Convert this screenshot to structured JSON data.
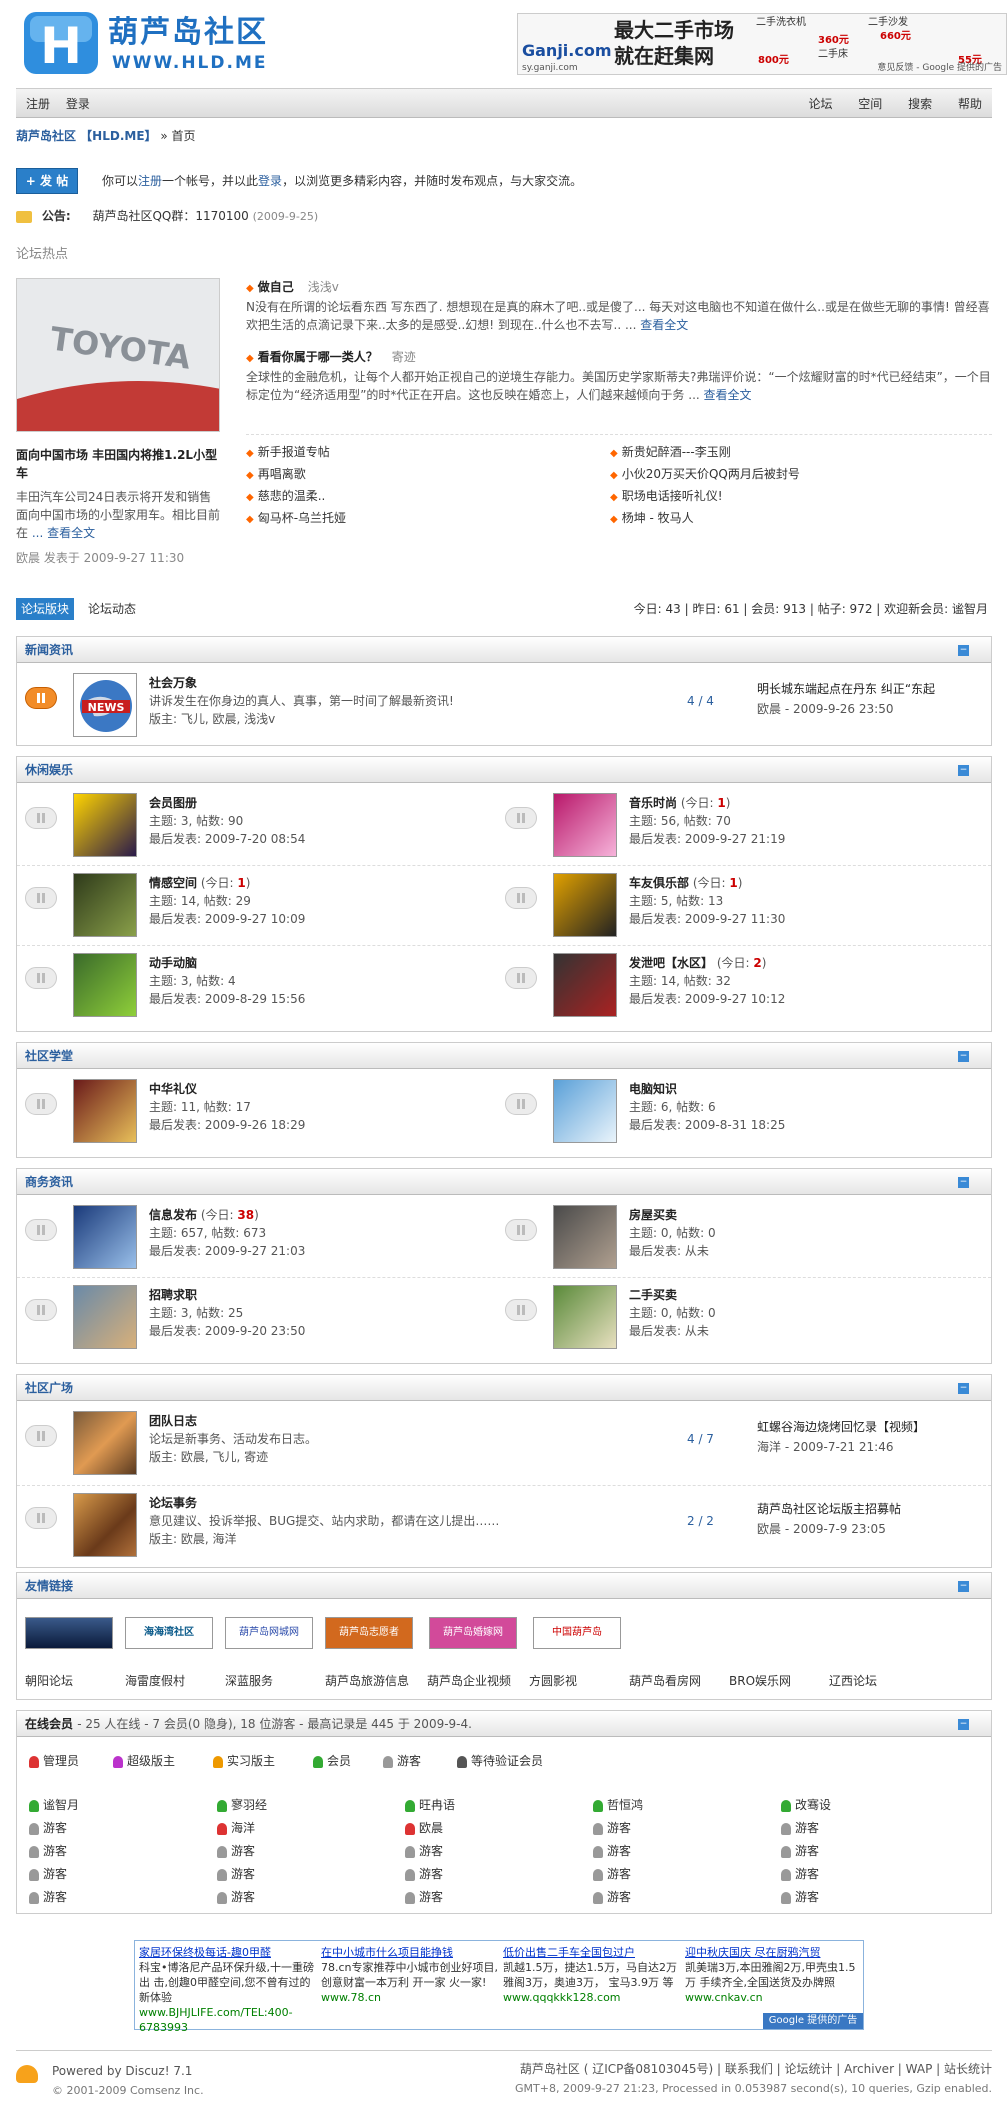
{
  "header": {
    "logo_title": "葫芦岛社区",
    "logo_url": "WWW.HLD.ME",
    "ad_brand": "Ganji.com",
    "ad_slogan1": "最大二手市场",
    "ad_slogan2": "就在赶集网",
    "ad_price1": "800元",
    "ad_price2": "360元",
    "ad_price3": "660元",
    "ad_price4": "55元",
    "ad_item1": "二手洗衣机",
    "ad_item2": "二手沙发",
    "ad_item3": "二手床",
    "ad_url": "sy.ganji.com",
    "ad_feedback": "意见反馈 - Google 提供的广告"
  },
  "nav": {
    "left": [
      "注册",
      "登录"
    ],
    "right": [
      "论坛",
      "空间",
      "搜索",
      "帮助"
    ]
  },
  "crumb": {
    "site": "葫芦岛社区 【HLD.ME】",
    "sep": "»",
    "page": "首页"
  },
  "post": {
    "button": "+ 发 帖",
    "text_pre": "你可以",
    "register": "注册",
    "text_mid": "一个帐号，并以此",
    "login": "登录",
    "text_post": "，以浏览更多精彩内容，并随时发布观点，与大家交流。"
  },
  "notice": {
    "label": "公告:",
    "text": "葫芦岛社区QQ群：1170100",
    "date": "(2009-9-25)"
  },
  "hot": {
    "label": "论坛热点",
    "img_text": "TOYOTA",
    "title": "面向中国市场 丰田国内将推1.2L小型车",
    "desc": "丰田汽车公司24日表示将开发和销售面向中国市场的小型家用车。相比目前在",
    "more": "... 查看全文",
    "author": "欧晨 发表于 2009-9-27 11:30",
    "items": [
      {
        "title": "做自己",
        "author": "浅浅v",
        "desc": "N没有在所谓的论坛看东西 写东西了. 想想现在是真的麻木了吧..或是傻了... 每天对这电脑也不知道在做什么..或是在做些无聊的事情! 曾经喜欢把生活的点滴记录下来..太多的是感受..幻想! 到现在..什么也不去写.. ...",
        "more": "查看全文"
      },
      {
        "title": "看看你属于哪一类人？",
        "author": "寄迹",
        "desc": "全球性的金融危机，让每个人都开始正视自己的逆境生存能力。美国历史学家斯蒂夫?弗瑞评价说：“一个炫耀财富的时*代已经结束”，一个目标定位为“经济适用型”的时*代正在开启。这也反映在婚恋上，人们越来越倾向于务 ...",
        "more": "查看全文"
      }
    ],
    "links_left": [
      "新手报道专帖",
      "再唱离歌",
      "慈悲的温柔..",
      "匈马杯-乌兰托娅"
    ],
    "links_right": [
      "新贵妃醉酒---李玉刚",
      "小伙20万买天价QQ两月后被封号",
      "职场电话接听礼仪!",
      "杨坤 - 牧马人"
    ]
  },
  "tabs": {
    "active": "论坛版块",
    "other": "论坛动态"
  },
  "stats": "今日: 43 | 昨日: 61 | 会员: 913 | 帖子: 972 | 欢迎新会员: 谧智月",
  "sections": [
    {
      "title": "新闻资讯",
      "collapse": "−",
      "forums": [
        {
          "name": "社会万象",
          "line2": "讲诉发生在你身边的真人、真事，第一时间了解最新资讯!",
          "line3": "版主: 飞儿, 欧晨, 浅浅v",
          "count": "4 / 4",
          "last_title": "明长城东端起点在丹东 纠正“东起",
          "last_author": "欧晨 - 2009-9-26 23:50"
        }
      ]
    },
    {
      "title": "休闲娱乐",
      "collapse": "−",
      "forums": [
        {
          "name": "会员图册",
          "today": "",
          "stats": "主题: 3, 帖数: 90",
          "last": "最后发表: 2009-7-20 08:54"
        },
        {
          "name": "音乐时尚",
          "today": "1",
          "stats": "主题: 56, 帖数: 70",
          "last": "最后发表: 2009-9-27 21:19"
        },
        {
          "name": "情感空间",
          "today": "1",
          "stats": "主题: 14, 帖数: 29",
          "last": "最后发表: 2009-9-27 10:09"
        },
        {
          "name": "车友俱乐部",
          "today": "1",
          "stats": "主题: 5, 帖数: 13",
          "last": "最后发表: 2009-9-27 11:30"
        },
        {
          "name": "动手动脑",
          "today": "",
          "stats": "主题: 3, 帖数: 4",
          "last": "最后发表: 2009-8-29 15:56"
        },
        {
          "name": "发泄吧【水区】",
          "today": "2",
          "stats": "主题: 14, 帖数: 32",
          "last": "最后发表: 2009-9-27 10:12"
        }
      ]
    },
    {
      "title": "社区学堂",
      "collapse": "−",
      "forums": [
        {
          "name": "中华礼仪",
          "today": "",
          "stats": "主题: 11, 帖数: 17",
          "last": "最后发表: 2009-9-26 18:29"
        },
        {
          "name": "电脑知识",
          "today": "",
          "stats": "主题: 6, 帖数: 6",
          "last": "最后发表: 2009-8-31 18:25"
        }
      ]
    },
    {
      "title": "商务资讯",
      "collapse": "−",
      "forums": [
        {
          "name": "信息发布",
          "today": "38",
          "stats": "主题: 657, 帖数: 673",
          "last": "最后发表: 2009-9-27 21:03"
        },
        {
          "name": "房屋买卖",
          "today": "",
          "stats": "主题: 0, 帖数: 0",
          "last": "最后发表: 从未"
        },
        {
          "name": "招聘求职",
          "today": "",
          "stats": "主题: 3, 帖数: 25",
          "last": "最后发表: 2009-9-20 23:50"
        },
        {
          "name": "二手买卖",
          "today": "",
          "stats": "主题: 0, 帖数: 0",
          "last": "最后发表: 从未"
        }
      ]
    },
    {
      "title": "社区广场",
      "collapse": "−",
      "forums": [
        {
          "name": "团队日志",
          "line2": "论坛是新事务、活动发布日志。",
          "line3": "版主: 欧晨, 飞儿, 寄迹",
          "count": "4 / 7",
          "last_title": "虹螺谷海边烧烤回忆录【视频】",
          "last_author": "海洋 - 2009-7-21 21:46"
        },
        {
          "name": "论坛事务",
          "line2": "意见建议、投诉举报、BUG提交、站内求助，都请在这儿提出……",
          "line3": "版主: 欧晨, 海洋",
          "count": "2 / 2",
          "last_title": "葫芦岛社区论坛版主招募帖",
          "last_author": "欧晨 - 2009-7-9 23:05"
        }
      ]
    }
  ],
  "today_prefix": "(今日: ",
  "today_suffix": ")",
  "links": {
    "title": "友情链接",
    "images": [
      "",
      "海海湾社区",
      "葫芦岛网城网",
      "葫芦岛志愿者",
      "葫芦岛婚嫁网",
      "中国葫芦岛"
    ],
    "text": [
      "朝阳论坛",
      "海雷度假村",
      "深蓝服务",
      "葫芦岛旅游信息",
      "葫芦岛企业视频",
      "方圆影视",
      "葫芦岛看房网",
      "BRO娱乐网",
      "辽西论坛"
    ]
  },
  "online": {
    "title": "在线会员",
    "summary": "- 25 人在线 - 7 会员(0 隐身), 18 位游客 - 最高记录是 445 于 2009-9-4.",
    "legend": [
      "管理员",
      "超级版主",
      "实习版主",
      "会员",
      "游客",
      "等待验证会员"
    ],
    "users": [
      "谧智月",
      "寥羽经",
      "旺冉语",
      "哲恒鸿",
      "改骞设",
      "游客",
      "海洋",
      "欧晨",
      "游客",
      "游客",
      "游客",
      "游客",
      "游客",
      "游客",
      "游客",
      "游客",
      "游客",
      "游客",
      "游客",
      "游客",
      "游客",
      "游客",
      "游客",
      "游客",
      "游客"
    ]
  },
  "ads": [
    {
      "h": "家居环保终极每话-趣0甲醛",
      "d": "科宝•博洛尼产品环保升级,十一重磅出 击,创趣0甲醛空间,您不曾有过的新体验",
      "u": "www.BJHJLIFE.com/TEL:400-6783993"
    },
    {
      "h": "在中小城市什么项目能挣钱",
      "d": "78.cn专家推荐中小城市创业好项目, 创意财富一本万利 开一家 火一家!",
      "u": "www.78.cn"
    },
    {
      "h": "低价出售二手车全国包过户",
      "d": "凯越1.5万，捷达1.5万，马自达2万 雅阁3万，奥迪3万， 宝马3.9万 等",
      "u": "www.qqqkkk128.com"
    },
    {
      "h": "迎中秋庆国庆 尽在厨鸦汽贸",
      "d": "凯美瑞3万,本田雅阁2万,甲壳虫1.5万 手续齐全,全国送货及办牌照",
      "u": "www.cnkav.cn"
    }
  ],
  "ad_google": "Google 提供的广告",
  "footer": {
    "powered": "Powered by Discuz! 7.1",
    "copy": "© 2001-2009 Comsenz Inc.",
    "right1": "葫芦岛社区 ( 辽ICP备08103045号) | 联系我们 | 论坛统计 | Archiver | WAP | 站长统计",
    "right2": "GMT+8, 2009-9-27 21:23, Processed in 0.053987 second(s), 10 queries, Gzip enabled."
  }
}
